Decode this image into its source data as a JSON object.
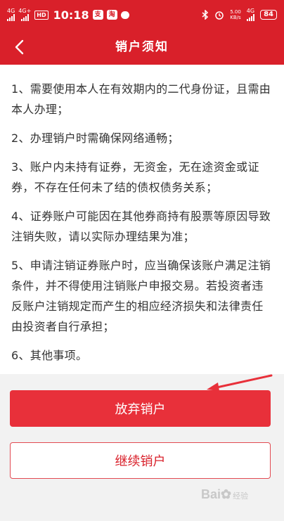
{
  "status_bar": {
    "network_1": "4G",
    "network_2": "4G+",
    "hd": "HD",
    "time": "10:18",
    "app_badge_1": "支",
    "app_badge_2": "淘",
    "speed_value": "5.00",
    "speed_unit": "KB/s",
    "network_3": "4G",
    "battery": "84"
  },
  "nav": {
    "title": "销户须知"
  },
  "notice": {
    "items": [
      "1、需要使用本人在有效期内的二代身份证，且需由本人办理；",
      "2、办理销户时需确保网络通畅；",
      "3、账户内未持有证券，无资金，无在途资金或证券，不存在任何未了结的债权债务关系；",
      "4、证券账户可能因在其他券商持有股票等原因导致注销失败，请以实际办理结果为准；",
      "5、申请注销证券账户时，应当确保该账户满足注销条件，并不得使用注销账户申报交易。若投资者违反账户注销规定而产生的相应经济损失和法律责任由投资者自行承担；",
      "6、其他事项。"
    ]
  },
  "actions": {
    "abandon_label": "放弃销户",
    "continue_label": "继续销户"
  },
  "watermark": {
    "brand": "Bai",
    "suffix": "经验"
  },
  "colors": {
    "brand_red": "#d9202a",
    "button_red": "#e8303a",
    "annotation_arrow": "#e8303a"
  }
}
